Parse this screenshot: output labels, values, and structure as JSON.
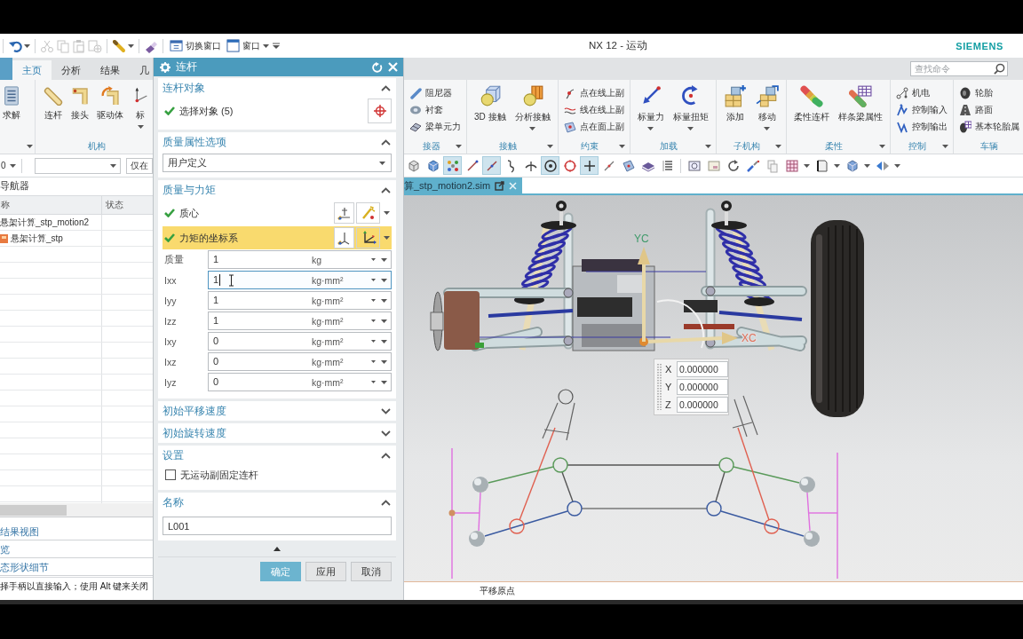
{
  "window": {
    "title": "NX 12 - 运动",
    "brand": "SIEMENS"
  },
  "quick_access": {
    "tools": [
      {
        "disabled": false,
        "menu": true
      },
      {
        "disabled": true,
        "menu": false
      },
      {
        "disabled": true,
        "menu": false
      },
      {
        "disabled": true,
        "menu": false
      },
      {
        "disabled": true,
        "menu": false
      },
      {
        "disabled": false,
        "menu": true
      },
      {
        "disabled": false,
        "menu": false
      }
    ],
    "commands": [
      {
        "label": "切换窗口",
        "menu": false
      },
      {
        "label": "窗口",
        "menu": true
      }
    ]
  },
  "ribbon_tabs": [
    {
      "label": "主页",
      "selected": true
    },
    {
      "label": "分析",
      "selected": false
    },
    {
      "label": "结果",
      "selected": false
    },
    {
      "label": "几",
      "selected": false
    }
  ],
  "search": {
    "placeholder": "查找命令"
  },
  "ribbon_left": [
    {
      "launcher": true,
      "kind": "large",
      "items": [
        {
          "label": "求解",
          "menu": false
        }
      ]
    },
    {
      "label": "机构",
      "launcher": false,
      "kind": "large",
      "items": [
        {
          "label": "连杆",
          "menu": false
        },
        {
          "label": "接头",
          "menu": false
        },
        {
          "label": "驱动体",
          "menu": false
        },
        {
          "label": "标",
          "menu": true
        }
      ]
    }
  ],
  "ribbon_right": [
    {
      "label": "接器",
      "launcher": true,
      "kind": "stack",
      "items": [
        {
          "label": "阻尼器"
        },
        {
          "label": "衬套"
        },
        {
          "label": "梁单元力"
        }
      ]
    },
    {
      "label": "接触",
      "launcher": true,
      "kind": "large",
      "items": [
        {
          "label": "3D 接触",
          "menu": false
        },
        {
          "label": "分析接触",
          "menu": true
        }
      ]
    },
    {
      "label": "约束",
      "launcher": true,
      "kind": "stack",
      "items": [
        {
          "label": "点在线上副"
        },
        {
          "label": "线在线上副"
        },
        {
          "label": "点在面上副"
        }
      ]
    },
    {
      "label": "加载",
      "launcher": true,
      "kind": "large",
      "items": [
        {
          "label": "标量力",
          "menu": true
        },
        {
          "label": "标量扭矩",
          "menu": true
        }
      ]
    },
    {
      "label": "子机构",
      "launcher": true,
      "kind": "large",
      "items": [
        {
          "label": "添加",
          "menu": false
        },
        {
          "label": "移动",
          "menu": true
        }
      ]
    },
    {
      "label": "柔性",
      "launcher": true,
      "kind": "large",
      "items": [
        {
          "label": "柔性连杆",
          "menu": false
        },
        {
          "label": "样条梁属性",
          "menu": false
        }
      ]
    },
    {
      "label": "控制",
      "launcher": true,
      "kind": "stack",
      "items": [
        {
          "label": "机电"
        },
        {
          "label": "控制输入"
        },
        {
          "label": "控制输出"
        }
      ]
    },
    {
      "label": "车辆",
      "launcher": false,
      "kind": "stack",
      "items": [
        {
          "label": "轮胎"
        },
        {
          "label": "路面"
        },
        {
          "label": "基本轮胎属"
        }
      ]
    }
  ],
  "selection_bar": {
    "filter": "0",
    "scope": "仅在"
  },
  "view_toolbar": [
    [
      {
        "selected": false,
        "menu": false
      },
      {
        "selected": false,
        "menu": false
      },
      {
        "selected": true,
        "menu": false
      },
      {
        "selected": false,
        "menu": false
      },
      {
        "selected": true,
        "menu": false
      },
      {
        "selected": false,
        "menu": false
      },
      {
        "selected": false,
        "menu": false
      },
      {
        "selected": true,
        "menu": false
      },
      {
        "selected": false,
        "menu": false
      },
      {
        "selected": true,
        "menu": false
      },
      {
        "selected": false,
        "menu": false
      },
      {
        "selected": false,
        "menu": false
      },
      {
        "selected": false,
        "menu": false
      },
      {
        "selected": false,
        "menu": false
      }
    ],
    [
      {
        "selected": false,
        "menu": false
      },
      {
        "selected": false,
        "menu": false
      },
      {
        "selected": false,
        "menu": false
      },
      {
        "selected": false,
        "menu": false
      },
      {
        "selected": false,
        "menu": false
      },
      {
        "selected": false,
        "menu": true
      },
      {
        "selected": false,
        "menu": true
      },
      {
        "selected": false,
        "menu": true
      },
      {
        "selected": false,
        "menu": true
      }
    ]
  ],
  "navigator": {
    "title": "导航器",
    "columns": [
      "称",
      "状态"
    ],
    "rows": [
      {
        "name": "悬架计算_stp_motion2",
        "kind": "root"
      },
      {
        "name": "悬架计算_stp",
        "kind": "part"
      }
    ],
    "panels": [
      "结果视图",
      "览",
      "态形状细节"
    ],
    "cue": "择手柄以直接输入；使用 Alt 键来关闭"
  },
  "document_tab": {
    "label": "算_stp_motion2.sim",
    "selected": true
  },
  "viewport": {
    "y_axis": "YC",
    "x_axis": "XC",
    "coordinates": [
      {
        "axis": "X",
        "value": "0.000000"
      },
      {
        "axis": "Y",
        "value": "0.000000"
      },
      {
        "axis": "Z",
        "value": "0.000000"
      }
    ]
  },
  "status": "平移原点",
  "dialog": {
    "title": "连杆",
    "sections": [
      {
        "kind": "selection",
        "title": "连杆对象",
        "expanded": true,
        "label": "选择对象 (5)",
        "complete": true
      },
      {
        "kind": "dropdown",
        "title": "质量属性选项",
        "expanded": true,
        "value": "用户定义"
      },
      {
        "kind": "mass",
        "title": "质量与力矩",
        "expanded": true,
        "points": [
          {
            "label": "质心",
            "complete": true,
            "selected": false
          },
          {
            "label": "力矩的坐标系",
            "complete": true,
            "selected": true
          }
        ],
        "fields": [
          {
            "label": "质量",
            "value": "1",
            "unit": "kg",
            "focused": false
          },
          {
            "label": "Ixx",
            "value": "1",
            "unit": "kg·mm²",
            "focused": true
          },
          {
            "label": "Iyy",
            "value": "1",
            "unit": "kg·mm²",
            "focused": false
          },
          {
            "label": "Izz",
            "value": "1",
            "unit": "kg·mm²",
            "focused": false
          },
          {
            "label": "Ixy",
            "value": "0",
            "unit": "kg·mm²",
            "focused": false
          },
          {
            "label": "Ixz",
            "value": "0",
            "unit": "kg·mm²",
            "focused": false
          },
          {
            "label": "Iyz",
            "value": "0",
            "unit": "kg·mm²",
            "focused": false
          }
        ]
      },
      {
        "kind": "header",
        "title": "初始平移速度",
        "expanded": false
      },
      {
        "kind": "header",
        "title": "初始旋转速度",
        "expanded": false
      },
      {
        "kind": "checkbox",
        "title": "设置",
        "expanded": true,
        "label": "无运动副固定连杆",
        "checked": false
      },
      {
        "kind": "text",
        "title": "名称",
        "expanded": true,
        "value": "L001"
      }
    ],
    "buttons": [
      {
        "label": "确定",
        "primary": true
      },
      {
        "label": "应用",
        "primary": false
      },
      {
        "label": "取消",
        "primary": false
      }
    ]
  }
}
